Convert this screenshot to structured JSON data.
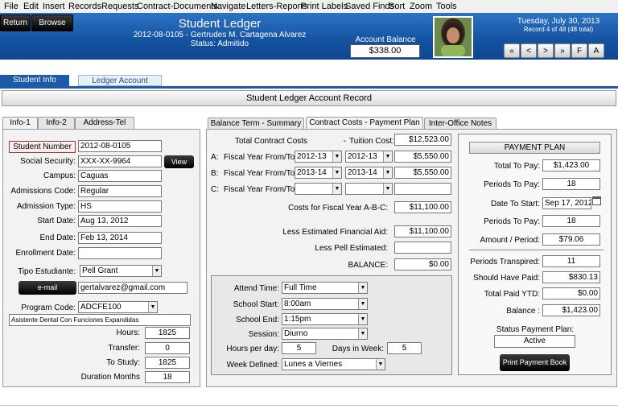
{
  "menu": [
    "File",
    "Edit",
    "Insert",
    "Records",
    "Requests",
    "Contract-Documents",
    "Navigate",
    "Letters-Reports",
    "Print Labels",
    "Saved Finds",
    "Sort",
    "Zoom",
    "Tools"
  ],
  "header": {
    "return_label": "Return",
    "browse_label": "Browse",
    "title": "Student Ledger",
    "subtitle": "2012-08-0105 - Gertrudes M. Cartagena Alvarez",
    "status": "Status: Admitido",
    "balance_label": "Account Balance",
    "balance_value": "$338.00",
    "date": "Tuesday, July 30, 2013",
    "record_info": "Record 4 of 48 (48 total)",
    "nav_buttons": [
      "«",
      "<",
      ">",
      "»",
      "F",
      "A"
    ]
  },
  "top_tabs": [
    "Student Info",
    "Ledger Account"
  ],
  "record_title": "Student  Ledger Account Record",
  "left_tabs": [
    "Info-1",
    "Info-2",
    "Address-Tel"
  ],
  "student": {
    "student_number_label": "Student Number",
    "student_number": "2012-08-0105",
    "ssn_label": "Social Security:",
    "ssn": "XXX-XX-9964",
    "view_label": "View",
    "campus_label": "Campus:",
    "campus": "Caguas",
    "admissions_code_label": "Admissions Code:",
    "admissions_code": "Regular",
    "admission_type_label": "Admission Type:",
    "admission_type": "HS",
    "start_date_label": "Start Date:",
    "start_date": "Aug 13, 2012",
    "end_date_label": "End Date:",
    "end_date": "Feb 13, 2014",
    "enrollment_date_label": "Enrollment Date:",
    "enrollment_date": "",
    "tipo_label": "Tipo Estudiante:",
    "tipo": "Pell Grant",
    "email_label": "e-mail",
    "email": "gertalvarez@gmail.com",
    "program_code_label": "Program Code:",
    "program_code": "ADCFE100",
    "program_name": "Asistente Dental Con Funciones Expandidas",
    "hours_label": "Hours:",
    "hours": "1825",
    "transfer_label": "Transfer:",
    "transfer": "0",
    "to_study_label": "To Study:",
    "to_study": "1825",
    "duration_label": "Duration Months",
    "duration": "18"
  },
  "mid_tabs": [
    "Balance Term - Summary",
    "Contract Costs - Payment Plan",
    "Inter-Office Notes"
  ],
  "costs": {
    "total_label": "Total Contract Costs",
    "dash": "-",
    "tuition_label": "Tuition Cost:",
    "tuition": "$12,523.00",
    "rows": [
      {
        "letter": "A:",
        "label": "Fiscal Year From/To:",
        "from": "2012-13",
        "to": "2012-13",
        "amount": "$5,550.00"
      },
      {
        "letter": "B:",
        "label": "Fiscal Year From/To:",
        "from": "2013-14",
        "to": "2013-14",
        "amount": "$5,550.00"
      },
      {
        "letter": "C:",
        "label": "Fiscal Year From/To:",
        "from": "",
        "to": "",
        "amount": ""
      }
    ],
    "fy_costs_label": "Costs for Fiscal Year A-B-C:",
    "fy_costs": "$11,100.00",
    "less_aid_label": "Less Estimated  Financial Aid:",
    "less_aid": "$11,100.00",
    "less_pell_label": "Less Pell Estimated:",
    "less_pell": "",
    "balance_label": "BALANCE:",
    "balance": "$0.00"
  },
  "schedule": {
    "attend_label": "Attend Time:",
    "attend": "Full Time",
    "school_start_label": "School Start:",
    "school_start": "8:00am",
    "school_end_label": "School End:",
    "school_end": "1:15pm",
    "session_label": "Session:",
    "session": "Diurno",
    "hours_day_label": "Hours per day:",
    "hours_day": "5",
    "days_week_label": "Days in Week:",
    "days_week": "5",
    "week_defined_label": "Week Defined:",
    "week_defined": "Lunes a Viernes"
  },
  "payment_plan": {
    "title": "PAYMENT PLAN",
    "total_to_pay_label": "Total To Pay:",
    "total_to_pay": "$1,423.00",
    "periods_to_pay_label": "Periods To Pay:",
    "periods_to_pay": "18",
    "date_to_start_label": "Date To Start:",
    "date_to_start": "Sep 17, 2012",
    "periods_to_pay2_label": "Periods To Pay:",
    "periods_to_pay2": "18",
    "amount_period_label": "Amount / Period:",
    "amount_period": "$79.06",
    "periods_transpired_label": "Periods Transpired:",
    "periods_transpired": "11",
    "should_have_paid_label": "Should Have Paid:",
    "should_have_paid": "$830.13",
    "total_paid_label": "Total Paid YTD:",
    "total_paid": "$0.00",
    "balance_label": "Balance :",
    "balance": "$1,423.00",
    "status_label": "Status Payment Plan:",
    "status": "Active",
    "print_label": "Print Payment Book"
  }
}
